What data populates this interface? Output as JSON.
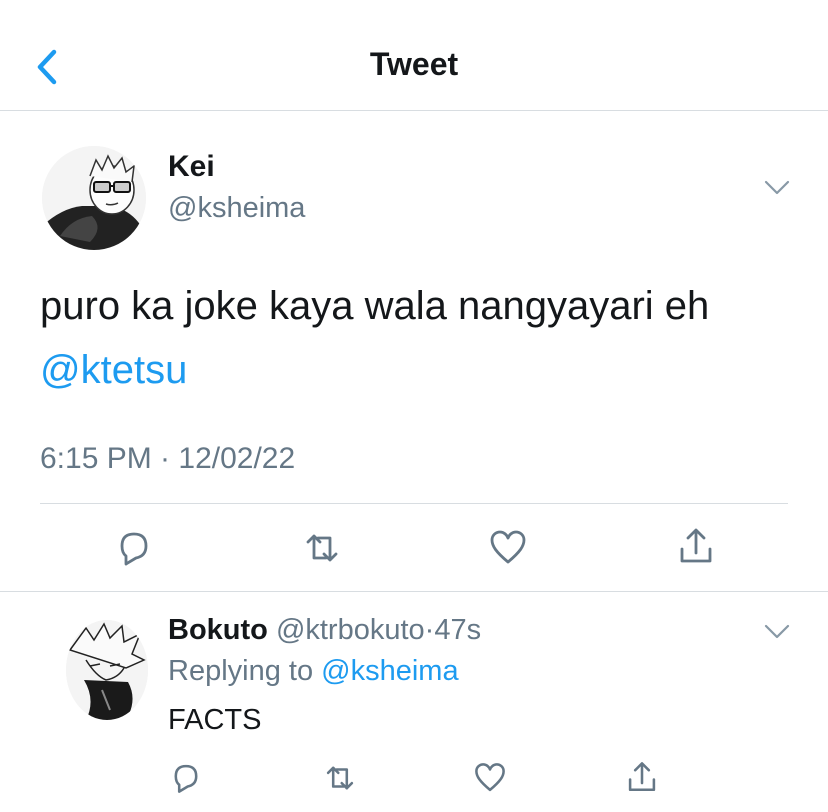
{
  "header": {
    "title": "Tweet"
  },
  "tweet": {
    "name": "Kei",
    "handle": "@ksheima",
    "text": "puro ka joke kaya wala nangyayari eh",
    "mention": "@ktetsu",
    "timestamp": "6:15 PM · 12/02/22"
  },
  "reply": {
    "name": "Bokuto",
    "handle": "@ktrbokuto",
    "separator": "·",
    "time": "47s",
    "replying_to_label": "Replying to",
    "replying_to_handle": "@ksheima",
    "text": "FACTS"
  },
  "icons": [
    "back-icon",
    "chevron-down-icon",
    "reply-icon",
    "retweet-icon",
    "like-icon",
    "share-icon"
  ],
  "colors": {
    "link": "#1d9bf0",
    "muted": "#657786",
    "divider": "#d8dde1",
    "icon": "#657786"
  }
}
